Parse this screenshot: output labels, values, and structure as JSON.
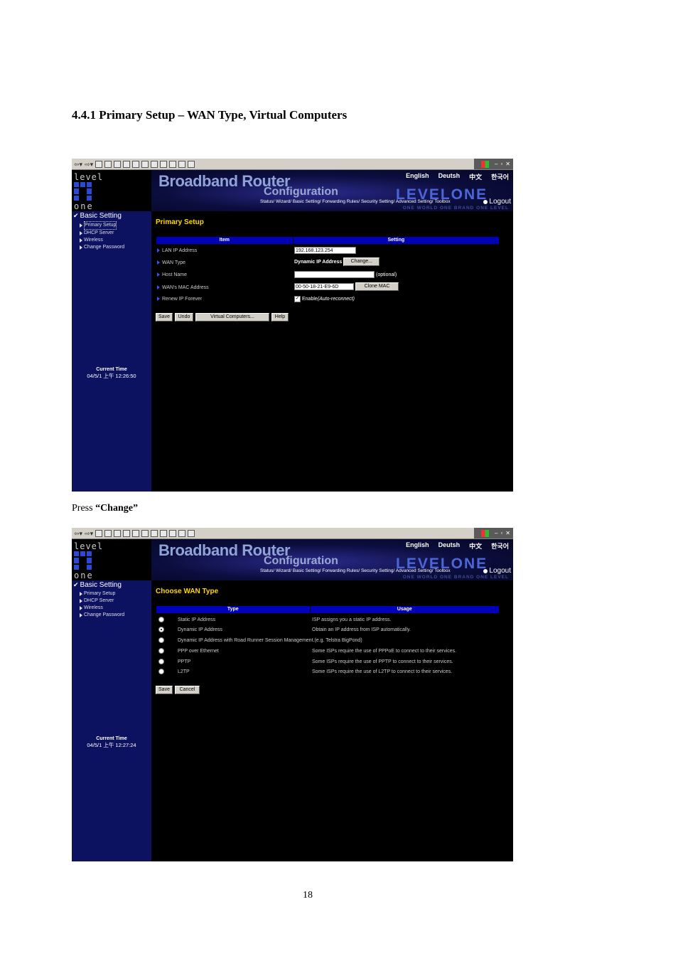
{
  "document": {
    "heading": "4.4.1 Primary Setup – WAN Type, Virtual Computers",
    "press_prefix": "Press ",
    "press_action": "“Change”",
    "page_number": "18"
  },
  "router": {
    "brand_title": "Broadband Router",
    "brand_subtitle": "Configuration",
    "brand_name": "LEVELONE",
    "slogan": "ONE WORLD ONE BRAND ONE LEVEL",
    "logo_top": "level",
    "logo_bottom": "one",
    "languages": [
      "English",
      "Deutsh",
      "中文",
      "한국어"
    ],
    "nav_links": "Status/ Wizard/ Basic Setting/ Forwarding Rules/ Security Setting/ Advanced Setting/ Toolbox",
    "logout": "Logout",
    "sidebar": {
      "section": "Basic Setting",
      "items": [
        "Primary Setup",
        "DHCP Server",
        "Wireless",
        "Change Password"
      ]
    },
    "time_label": "Current Time"
  },
  "screen1": {
    "time_value": "04/5/1 上午 12:26:50",
    "title": "Primary Setup",
    "col_item": "Item",
    "col_setting": "Setting",
    "rows": {
      "lan_ip": {
        "label": "LAN IP Address",
        "value": "192.168.123.254"
      },
      "wan_type": {
        "label": "WAN Type",
        "value": "Dynamic IP Address",
        "button": "Change..."
      },
      "host_name": {
        "label": "Host Name",
        "value": "",
        "note": "(optional)"
      },
      "wan_mac": {
        "label": "WAN's MAC Address",
        "value": "00-50-18-21-E9-6D",
        "button": "Clone MAC"
      },
      "renew": {
        "label": "Renew IP Forever",
        "checkbox_label": "Enable",
        "checkbox_note": "(Auto-reconnect)"
      }
    },
    "buttons": {
      "save": "Save",
      "undo": "Undo",
      "virtual": "Virtual Computers...",
      "help": "Help"
    }
  },
  "screen2": {
    "time_value": "04/5/1 上午 12:27:24",
    "title": "Choose WAN Type",
    "col_type": "Type",
    "col_usage": "Usage",
    "options": [
      {
        "type": "Static IP Address",
        "usage": "ISP assigns you a static IP address.",
        "selected": false
      },
      {
        "type": "Dynamic IP Address",
        "usage": "Obtain an IP address from ISP automatically.",
        "selected": true
      },
      {
        "type": "Dynamic IP Address with Road Runner Session Management.(e.g. Telstra BigPond)",
        "usage": "",
        "selected": false
      },
      {
        "type": "PPP over Ethernet",
        "usage": "Some ISPs require the use of PPPoE to connect to their services.",
        "selected": false
      },
      {
        "type": "PPTP",
        "usage": "Some ISPs require the use of PPTP to connect to their services.",
        "selected": false
      },
      {
        "type": "L2TP",
        "usage": "Some ISPs require the use of L2TP to connect to their services.",
        "selected": false
      }
    ],
    "buttons": {
      "save": "Save",
      "cancel": "Cancel"
    }
  },
  "colors": {
    "sidebar": "#0d1260",
    "title_yellow": "#ffd700",
    "table_header": "#0000b8",
    "brand_blue": "#4c66d8"
  }
}
